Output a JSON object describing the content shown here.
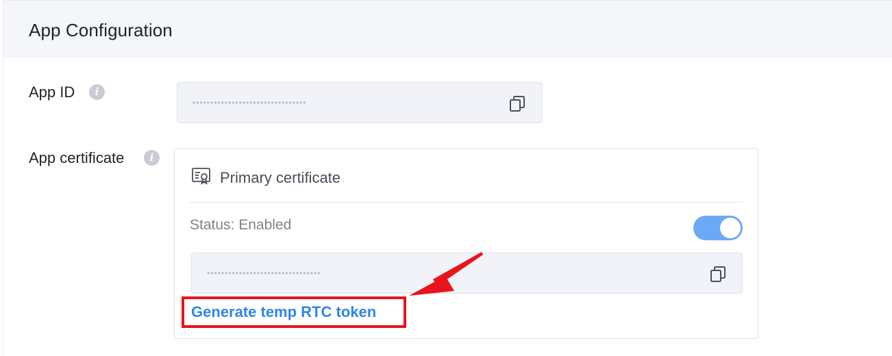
{
  "section": {
    "title": "App Configuration"
  },
  "app_id": {
    "label": "App ID",
    "masked_value": "••••••••••••••••••••••••••••••••"
  },
  "app_certificate": {
    "label": "App certificate",
    "card": {
      "title": "Primary certificate",
      "status": "Status: Enabled",
      "toggle_on": true,
      "masked_value": "••••••••••••••••••••••••••••••••",
      "generate_link": "Generate temp RTC token"
    }
  },
  "icons": {
    "info": "info-icon",
    "copy": "copy-icon",
    "certificate": "certificate-icon"
  },
  "colors": {
    "link": "#2f86e6",
    "toggle_on": "#6ba9f6",
    "annotation": "#e8141b"
  }
}
